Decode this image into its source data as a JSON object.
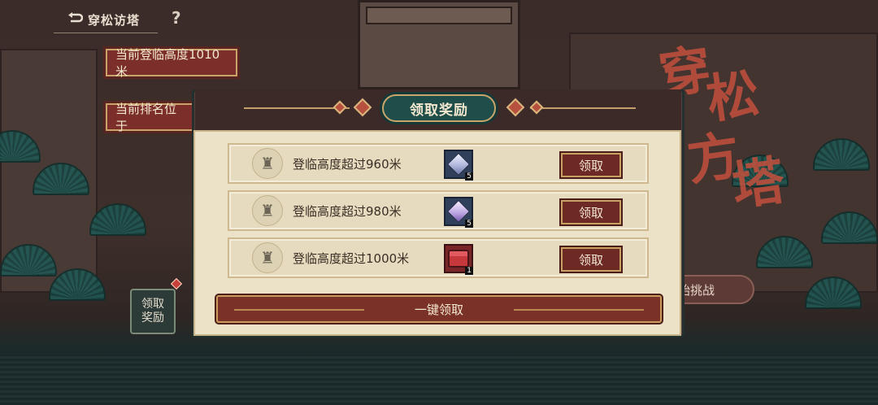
{
  "header": {
    "title": "穿松访塔",
    "help": "?"
  },
  "info": {
    "current_height": "当前登临高度1010米",
    "current_rank": "当前排名位于"
  },
  "side_button": {
    "label_line1": "领取",
    "label_line2": "奖励"
  },
  "title_art": [
    "穿",
    "松",
    "方",
    "塔"
  ],
  "challenge_button": {
    "label": "始挑战"
  },
  "modal": {
    "title": "领取奖励",
    "rewards": [
      {
        "condition": "登临高度超过960米",
        "item": "crystal-white",
        "count": "5",
        "button": "领取"
      },
      {
        "condition": "登临高度超过980米",
        "item": "crystal-purple",
        "count": "5",
        "button": "领取"
      },
      {
        "condition": "登临高度超过1000米",
        "item": "treasure-chest",
        "count": "1",
        "button": "领取"
      }
    ],
    "claim_all": "一键领取"
  },
  "colors": {
    "parchment": "#ece2c7",
    "button_red": "#6d2a25",
    "teal_plate": "#1f4e4a",
    "gold_border": "#c9a46a"
  }
}
